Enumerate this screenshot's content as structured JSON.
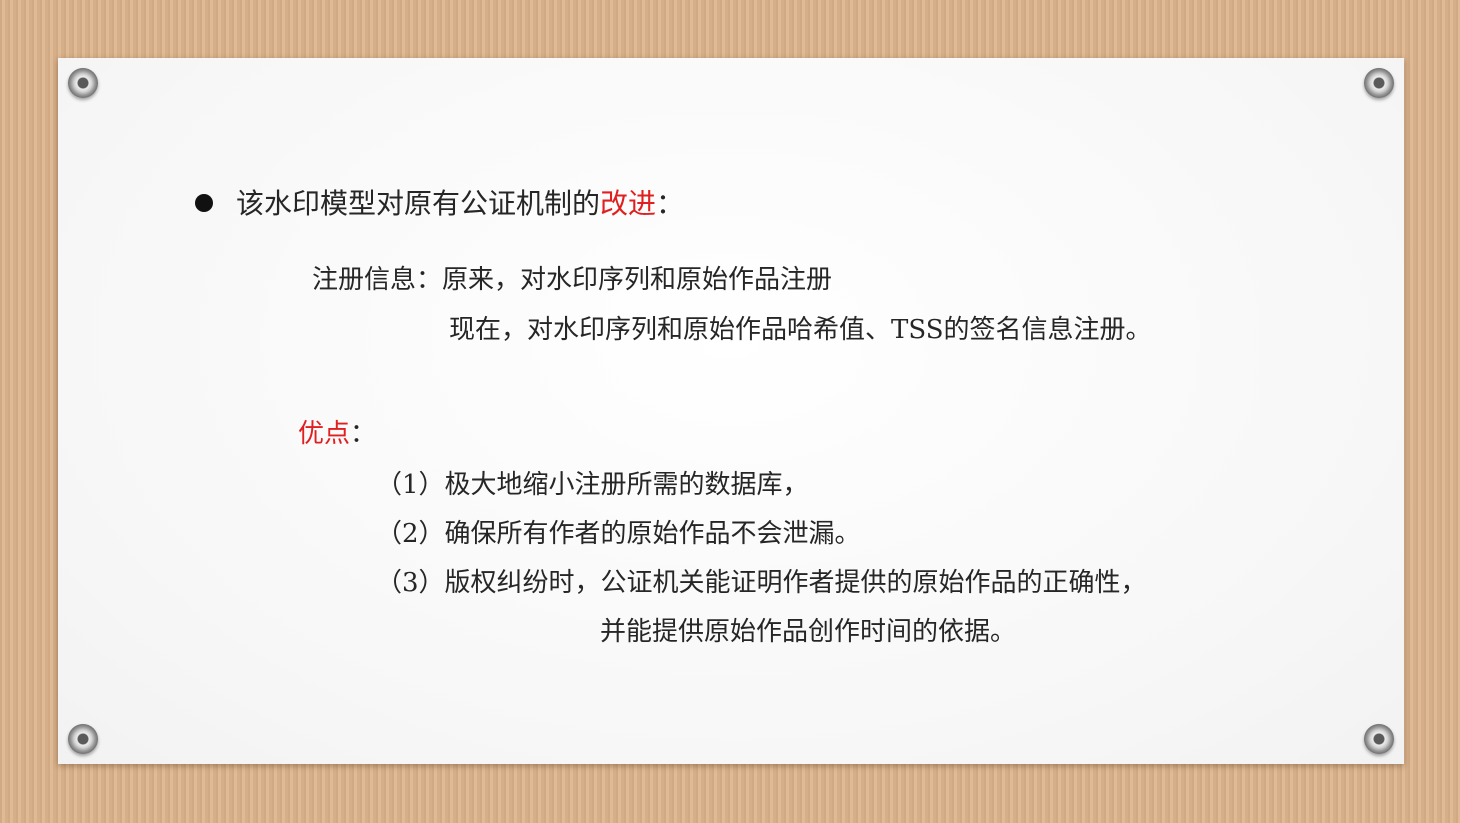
{
  "slide": {
    "heading": {
      "prefix": "该水印模型对原有公证机制的",
      "highlight": "改进",
      "suffix": "："
    },
    "registration": {
      "label": "注册信息：",
      "before": "原来，对水印序列和原始作品注册",
      "after": "现在，对水印序列和原始作品哈希值、TSS的签名信息注册。"
    },
    "advantages": {
      "title": "优点",
      "colon": "：",
      "items": [
        "（1）极大地缩小注册所需的数据库，",
        "（2）确保所有作者的原始作品不会泄漏。",
        "（3）版权纠纷时，公证机关能证明作者提供的原始作品的正确性，"
      ],
      "item3_continuation": "并能提供原始作品创作时间的依据。"
    },
    "colors": {
      "highlight": "#e02020",
      "text": "#262626",
      "background": "#dbb48e",
      "paper": "#fafafa"
    },
    "icons": [
      "bullet-dot",
      "pushpin"
    ]
  }
}
